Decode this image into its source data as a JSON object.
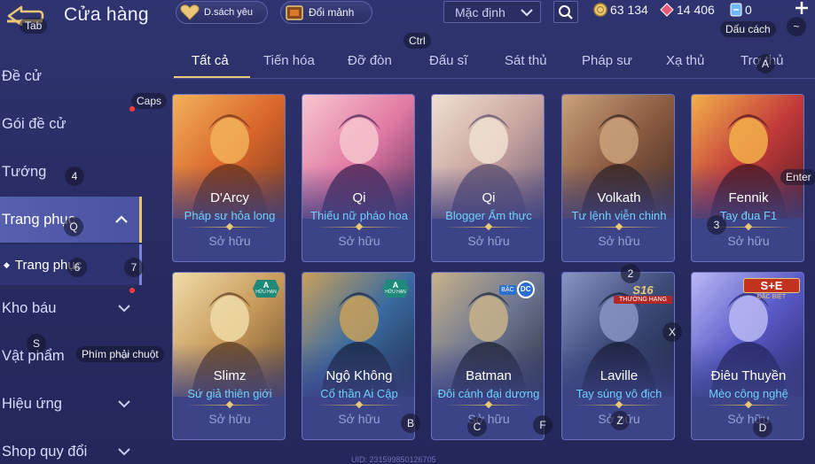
{
  "header": {
    "title": "Cửa hàng",
    "wishlist_label": "D.sách yêu",
    "shards_label": "Đổi mảnh",
    "sort_value": "Mặc định",
    "currencies": [
      {
        "name": "gold",
        "value": "63 134"
      },
      {
        "name": "gems",
        "value": "14 406"
      },
      {
        "name": "vouchers",
        "value": "0"
      }
    ]
  },
  "sidebar": {
    "items": [
      {
        "label": "Đề cử"
      },
      {
        "label": "Gói đề cử"
      },
      {
        "label": "Tướng"
      },
      {
        "label": "Trang phục"
      },
      {
        "label": "Trang phục"
      },
      {
        "label": "Kho báu"
      },
      {
        "label": "Vật phẩm"
      },
      {
        "label": "Hiệu ứng"
      },
      {
        "label": "Shop quy đổi"
      }
    ]
  },
  "tabs": [
    {
      "label": "Tất cả"
    },
    {
      "label": "Tiến hóa"
    },
    {
      "label": "Đỡ đòn"
    },
    {
      "label": "Đấu sĩ"
    },
    {
      "label": "Sát thủ"
    },
    {
      "label": "Pháp sư"
    },
    {
      "label": "Xạ thủ"
    },
    {
      "label": "Trợ thủ"
    }
  ],
  "cards": [
    {
      "hero": "D'Arcy",
      "skin": "Pháp sư hỏa long",
      "status": "Sở hữu",
      "palette": [
        "#7a3a1c",
        "#d9662b",
        "#f2b25a"
      ]
    },
    {
      "hero": "Qi",
      "skin": "Thiếu nữ pháo hoa",
      "status": "Sở hữu",
      "palette": [
        "#5a2e5c",
        "#e27aa3",
        "#f6c6cf"
      ]
    },
    {
      "hero": "Qi",
      "skin": "Blogger Ẩm thực",
      "status": "Sở hữu",
      "palette": [
        "#6a5a74",
        "#c9a5a0",
        "#efe0d2"
      ]
    },
    {
      "hero": "Volkath",
      "skin": "Tư lệnh viễn chinh",
      "status": "Sở hữu",
      "palette": [
        "#3e2a24",
        "#8a5a40",
        "#caa27a"
      ]
    },
    {
      "hero": "Fennik",
      "skin": "Tay đua F1",
      "status": "Sở hữu",
      "palette": [
        "#5a1c22",
        "#c23a3a",
        "#f3b04a"
      ]
    },
    {
      "hero": "Slimz",
      "skin": "Sứ giả thiên giới",
      "status": "Sở hữu",
      "palette": [
        "#6a4a2a",
        "#c79a5a",
        "#f0dca8"
      ],
      "badge": "A"
    },
    {
      "hero": "Ngộ Không",
      "skin": "Cổ thần Ai Cập",
      "status": "Sở hữu",
      "palette": [
        "#1e2e4a",
        "#3a6aa0",
        "#c9a15a"
      ],
      "badge": "A"
    },
    {
      "hero": "Batman",
      "skin": "Đôi cánh đại dương",
      "status": "Sở hữu",
      "palette": [
        "#2a3040",
        "#6c7590",
        "#c8b38a"
      ],
      "badge": "DC"
    },
    {
      "hero": "Laville",
      "skin": "Tay súng vô địch",
      "status": "Sở hữu",
      "palette": [
        "#1e2440",
        "#3c4a78",
        "#8a94c4"
      ],
      "badge": "S16"
    },
    {
      "hero": "Điêu Thuyền",
      "skin": "Mèo công nghệ",
      "status": "Sở hữu",
      "palette": [
        "#2a2a6a",
        "#5a5ac8",
        "#b8b8f4"
      ],
      "badge": "S+"
    }
  ],
  "badges": {
    "a_label": "A",
    "a_sub": "HỮU HẠN",
    "dc_prefix": "BẬC",
    "dc_mark": "DC",
    "s16_top": "S16",
    "s16_bottom": "THƯỜNG HẠNG",
    "splus_top": "S+E",
    "splus_bottom": "ĐẶC BIỆT"
  },
  "overlay_hints": [
    {
      "label": "Tab"
    },
    {
      "label": "Ctrl"
    },
    {
      "label": "Dấu cách"
    },
    {
      "label": "~"
    },
    {
      "label": "A"
    },
    {
      "label": "Caps"
    },
    {
      "label": "4"
    },
    {
      "label": "Enter"
    },
    {
      "label": "3"
    },
    {
      "label": "Q"
    },
    {
      "label": "6"
    },
    {
      "label": "7"
    },
    {
      "label": "2"
    },
    {
      "label": "X"
    },
    {
      "label": "S"
    },
    {
      "label": "Phím phải chuột"
    },
    {
      "label": "B"
    },
    {
      "label": "C"
    },
    {
      "label": "F"
    },
    {
      "label": "Z"
    },
    {
      "label": "D"
    }
  ],
  "footer": {
    "uid": "UID: 231599850126705"
  },
  "colors": {
    "accent_gold": "#e9c978",
    "skin_name": "#6fd0ff",
    "bg": "#2f3470"
  }
}
